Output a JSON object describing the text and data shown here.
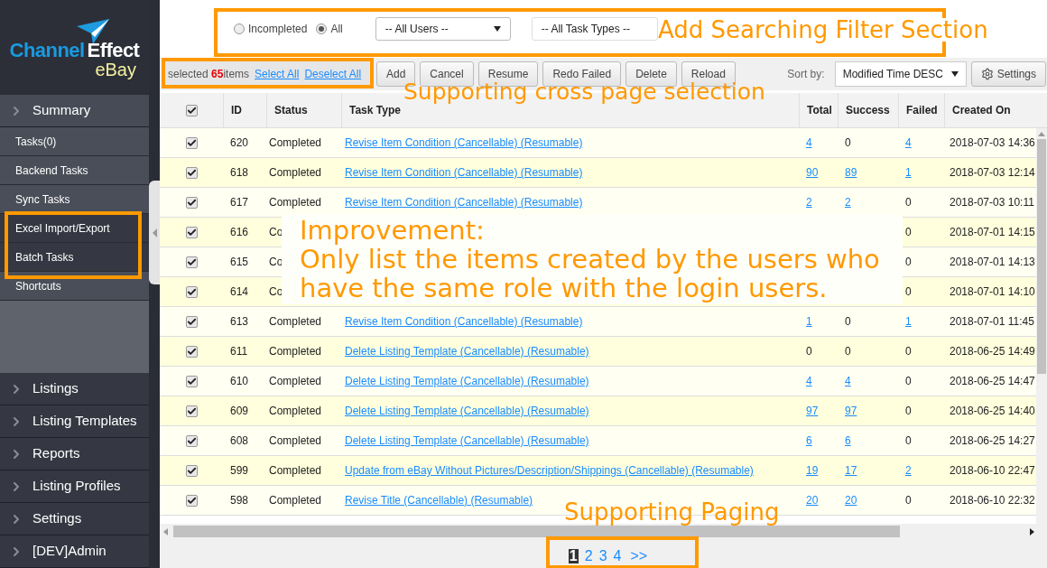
{
  "logo": {
    "word_left": "Channel",
    "word_right": "Effect",
    "sub": "eBay"
  },
  "sidebar": {
    "sections": [
      {
        "label": "Summary",
        "expanded": true,
        "children": [
          {
            "label": "Tasks(0)",
            "highlighted": false
          },
          {
            "label": "Backend Tasks",
            "highlighted": false
          },
          {
            "label": "Sync Tasks",
            "highlighted": false
          },
          {
            "label": "Excel Import/Export",
            "highlighted": true
          },
          {
            "label": "Batch Tasks",
            "highlighted": true
          },
          {
            "label": "Shortcuts",
            "highlighted": false
          }
        ]
      },
      {
        "label": "Listings",
        "expanded": false
      },
      {
        "label": "Listing Templates",
        "expanded": false
      },
      {
        "label": "Reports",
        "expanded": false
      },
      {
        "label": "Listing Profiles",
        "expanded": false
      },
      {
        "label": "Settings",
        "expanded": false
      },
      {
        "label": "[DEV]Admin",
        "expanded": false
      }
    ]
  },
  "filters": {
    "status_options": [
      {
        "label": "Incompleted",
        "selected": false
      },
      {
        "label": "All",
        "selected": true
      }
    ],
    "users_select": "-- All Users --",
    "task_types_select": "-- All Task Types --"
  },
  "selection": {
    "prefix": "selected",
    "count": "65",
    "suffix": "items",
    "select_all": "Select All",
    "deselect_all": "Deselect All"
  },
  "toolbar": {
    "buttons": [
      "Add",
      "Cancel",
      "Resume",
      "Redo Failed",
      "Delete",
      "Reload"
    ],
    "sort_label": "Sort by:",
    "sort_value": "Modified Time DESC",
    "settings_button": "Settings"
  },
  "table": {
    "header_checked": true,
    "columns": [
      "ID",
      "Status",
      "Task Type",
      "Total",
      "Success",
      "Failed",
      "Created On"
    ],
    "rows": [
      {
        "checked": true,
        "id": "620",
        "status": "Completed",
        "task_type": "Revise Item Condition (Cancellable) (Resumable)",
        "total": {
          "text": "4",
          "link": true
        },
        "success": {
          "text": "0",
          "link": false
        },
        "failed": {
          "text": "4",
          "link": true
        },
        "created_on": "2018-07-03 14:36"
      },
      {
        "checked": true,
        "id": "618",
        "status": "Completed",
        "task_type": "Revise Item Condition (Cancellable) (Resumable)",
        "total": {
          "text": "90",
          "link": true
        },
        "success": {
          "text": "89",
          "link": true
        },
        "failed": {
          "text": "1",
          "link": true
        },
        "created_on": "2018-07-03 12:14"
      },
      {
        "checked": true,
        "id": "617",
        "status": "Completed",
        "task_type": "Revise Item Condition (Cancellable) (Resumable)",
        "total": {
          "text": "2",
          "link": true
        },
        "success": {
          "text": "2",
          "link": true
        },
        "failed": {
          "text": "0",
          "link": false
        },
        "created_on": "2018-07-03 10:11"
      },
      {
        "checked": true,
        "id": "616",
        "status": "Co",
        "failed": {
          "text": "0",
          "link": false
        },
        "created_on": "2018-07-01 14:15"
      },
      {
        "checked": true,
        "id": "615",
        "status": "Co",
        "failed": {
          "text": "0",
          "link": false
        },
        "created_on": "2018-07-01 14:13"
      },
      {
        "checked": true,
        "id": "614",
        "status": "Co",
        "failed": {
          "text": "0",
          "link": false
        },
        "created_on": "2018-07-01 14:10"
      },
      {
        "checked": true,
        "id": "613",
        "status": "Completed",
        "task_type": "Revise Item Condition (Cancellable) (Resumable)",
        "total": {
          "text": "1",
          "link": true
        },
        "success": {
          "text": "0",
          "link": false
        },
        "failed": {
          "text": "1",
          "link": true
        },
        "created_on": "2018-07-01 11:45"
      },
      {
        "checked": true,
        "id": "611",
        "status": "Completed",
        "task_type": "Delete Listing Template (Cancellable) (Resumable)",
        "total": {
          "text": "0",
          "link": false
        },
        "success": {
          "text": "0",
          "link": false
        },
        "failed": {
          "text": "0",
          "link": false
        },
        "created_on": "2018-06-25 14:49"
      },
      {
        "checked": true,
        "id": "610",
        "status": "Completed",
        "task_type": "Delete Listing Template (Cancellable) (Resumable)",
        "total": {
          "text": "4",
          "link": true
        },
        "success": {
          "text": "4",
          "link": true
        },
        "failed": {
          "text": "0",
          "link": false
        },
        "created_on": "2018-06-25 14:47"
      },
      {
        "checked": true,
        "id": "609",
        "status": "Completed",
        "task_type": "Delete Listing Template (Cancellable) (Resumable)",
        "total": {
          "text": "97",
          "link": true
        },
        "success": {
          "text": "97",
          "link": true
        },
        "failed": {
          "text": "0",
          "link": false
        },
        "created_on": "2018-06-25 14:40"
      },
      {
        "checked": true,
        "id": "608",
        "status": "Completed",
        "task_type": "Delete Listing Template (Cancellable) (Resumable)",
        "total": {
          "text": "6",
          "link": true
        },
        "success": {
          "text": "6",
          "link": true
        },
        "failed": {
          "text": "0",
          "link": false
        },
        "created_on": "2018-06-25 14:27"
      },
      {
        "checked": true,
        "id": "599",
        "status": "Completed",
        "task_type": "Update from eBay Without Pictures/Description/Shippings (Cancellable) (Resumable)",
        "total": {
          "text": "19",
          "link": true
        },
        "success": {
          "text": "17",
          "link": true
        },
        "failed": {
          "text": "2",
          "link": true
        },
        "created_on": "2018-06-10 22:47"
      },
      {
        "checked": true,
        "id": "598",
        "status": "Completed",
        "task_type": "Revise Title (Cancellable) (Resumable)",
        "total": {
          "text": "20",
          "link": true
        },
        "success": {
          "text": "20",
          "link": true
        },
        "failed": {
          "text": "0",
          "link": false
        },
        "created_on": "2018-06-10 22:32"
      }
    ]
  },
  "pagination": {
    "pages": [
      {
        "label": "1",
        "selected": true
      },
      {
        "label": "2",
        "selected": false
      },
      {
        "label": "3",
        "selected": false
      },
      {
        "label": "4",
        "selected": false
      }
    ],
    "next": ">>"
  },
  "annotations": [
    {
      "kind": "filter",
      "text": "Add Searching Filter Section"
    },
    {
      "kind": "selection",
      "text": "Supporting cross page selection"
    },
    {
      "kind": "sidebar"
    },
    {
      "kind": "improvement",
      "lines": [
        "Improvement:",
        "Only list the items created by the users who",
        "have the same role with the login users."
      ]
    },
    {
      "kind": "paging",
      "text": "Supporting Paging"
    }
  ]
}
